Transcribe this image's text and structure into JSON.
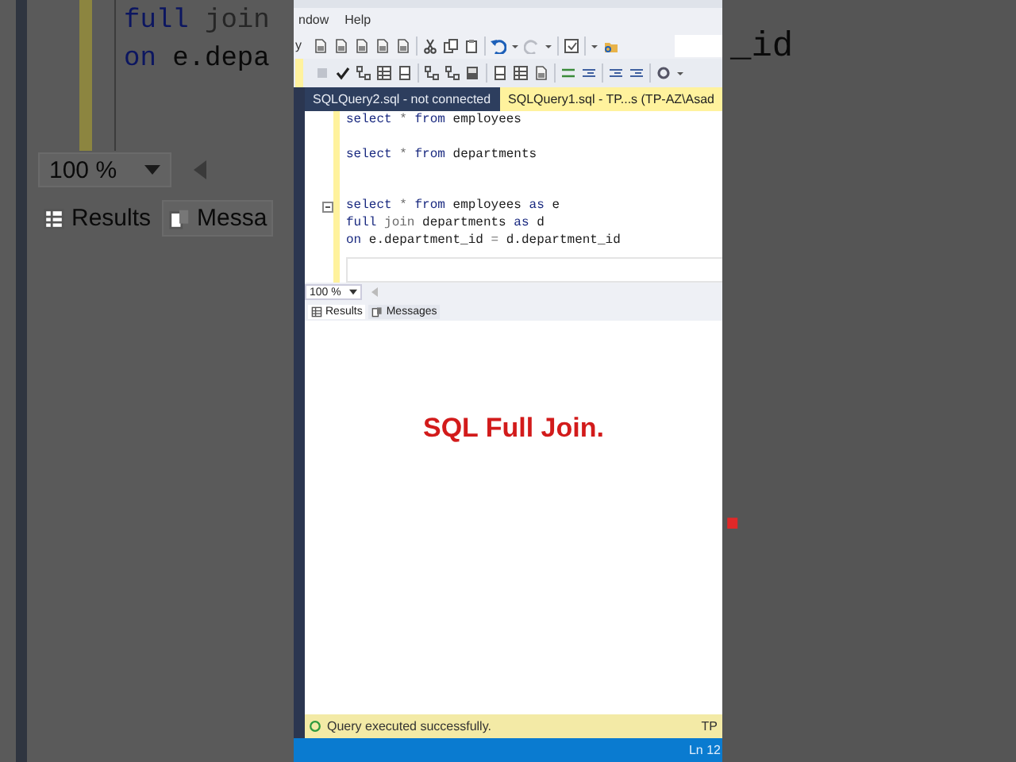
{
  "backdrop": {
    "code_lines": [
      {
        "tokens": [
          {
            "text": "full",
            "kind": "keyword"
          },
          {
            "text": "join",
            "kind": "operator"
          }
        ]
      },
      {
        "tokens": [
          {
            "text": "on",
            "kind": "keyword"
          },
          {
            "text": "e.depa",
            "kind": "text"
          }
        ]
      }
    ],
    "tail": "_id",
    "zoom": "100 %",
    "tabs": [
      {
        "label": "Results",
        "kind": "grid"
      },
      {
        "label": "Messa",
        "kind": "messages"
      }
    ],
    "caption_end": "."
  },
  "window": {
    "menu": [
      "ndow",
      "Help"
    ],
    "toolbar_fragment": "y",
    "tabs": [
      {
        "label": "SQLQuery2.sql - not connected",
        "selected": false
      },
      {
        "label": "SQLQuery1.sql - TP...s (TP-AZ\\Asad",
        "selected": true
      }
    ],
    "editor": {
      "lines": [
        {
          "kind": "code",
          "fold": false,
          "tokens": [
            {
              "text": "select",
              "kind": "keyword"
            },
            {
              "text": "*",
              "kind": "operator"
            },
            {
              "text": "from",
              "kind": "keyword"
            },
            {
              "text": "employees",
              "kind": "text"
            }
          ]
        },
        {
          "kind": "blank",
          "fold": false
        },
        {
          "kind": "code",
          "fold": false,
          "tokens": [
            {
              "text": "select",
              "kind": "keyword"
            },
            {
              "text": "*",
              "kind": "operator"
            },
            {
              "text": "from",
              "kind": "keyword"
            },
            {
              "text": "departments",
              "kind": "text"
            }
          ]
        },
        {
          "kind": "blank",
          "fold": false
        },
        {
          "kind": "blank",
          "fold": false
        },
        {
          "kind": "code",
          "fold": true,
          "tokens": [
            {
              "text": "select",
              "kind": "keyword"
            },
            {
              "text": "*",
              "kind": "operator"
            },
            {
              "text": "from",
              "kind": "keyword"
            },
            {
              "text": "employees",
              "kind": "text"
            },
            {
              "text": "as",
              "kind": "keyword"
            },
            {
              "text": "e",
              "kind": "text"
            }
          ]
        },
        {
          "kind": "code",
          "fold": false,
          "tokens": [
            {
              "text": "full",
              "kind": "keyword"
            },
            {
              "text": "join",
              "kind": "operator"
            },
            {
              "text": "departments",
              "kind": "text"
            },
            {
              "text": "as",
              "kind": "keyword"
            },
            {
              "text": "d",
              "kind": "text"
            }
          ]
        },
        {
          "kind": "code",
          "fold": false,
          "tokens": [
            {
              "text": "on",
              "kind": "keyword"
            },
            {
              "text": "e.department_id",
              "kind": "text"
            },
            {
              "text": "=",
              "kind": "operator"
            },
            {
              "text": "d.department_id",
              "kind": "text"
            }
          ]
        }
      ]
    },
    "zoom": "100 %",
    "result_tabs": [
      {
        "label": "Results",
        "kind": "grid",
        "selected": true
      },
      {
        "label": "Messages",
        "kind": "messages",
        "selected": false
      }
    ],
    "caption": "SQL Full Join.",
    "status": {
      "message": "Query executed successfully.",
      "server": "TP"
    },
    "position": "Ln 12"
  }
}
